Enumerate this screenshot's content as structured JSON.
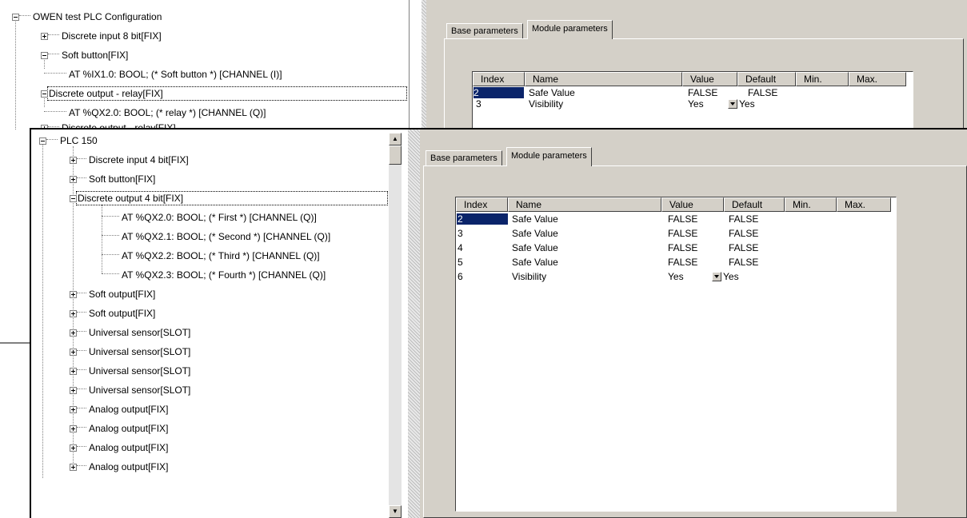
{
  "back_window": {
    "tree": {
      "root": "OWEN test PLC Configuration",
      "items": [
        {
          "label": "Discrete input 8 bit[FIX]"
        },
        {
          "label": "Soft button[FIX]"
        },
        {
          "label": "AT %IX1.0: BOOL; (* Soft button *) [CHANNEL (I)]"
        },
        {
          "label": "Discrete output - relay[FIX]"
        },
        {
          "label": "AT %QX2.0: BOOL; (* relay *) [CHANNEL (Q)]"
        },
        {
          "label": "Discrete output - relay[FIX]"
        }
      ]
    },
    "tabs": {
      "base": "Base parameters",
      "module": "Module parameters"
    },
    "grid": {
      "columns": [
        "Index",
        "Name",
        "Value",
        "Default",
        "Min.",
        "Max."
      ],
      "rows": [
        {
          "index": "2",
          "name": "Safe Value",
          "value": "FALSE",
          "default": "FALSE"
        },
        {
          "index": "3",
          "name": "Visibility",
          "value": "Yes",
          "default": "Yes"
        }
      ]
    }
  },
  "front_window": {
    "tree": {
      "root": "PLC 150",
      "items": [
        {
          "label": "Discrete input 4 bit[FIX]"
        },
        {
          "label": "Soft button[FIX]"
        },
        {
          "label": "Discrete output 4 bit[FIX]"
        },
        {
          "label": "AT %QX2.0: BOOL; (* First *) [CHANNEL (Q)]"
        },
        {
          "label": "AT %QX2.1: BOOL; (* Second *) [CHANNEL (Q)]"
        },
        {
          "label": "AT %QX2.2: BOOL; (* Third *) [CHANNEL (Q)]"
        },
        {
          "label": "AT %QX2.3: BOOL; (* Fourth *) [CHANNEL (Q)]"
        },
        {
          "label": "Soft output[FIX]"
        },
        {
          "label": "Soft output[FIX]"
        },
        {
          "label": "Universal sensor[SLOT]"
        },
        {
          "label": "Universal sensor[SLOT]"
        },
        {
          "label": "Universal sensor[SLOT]"
        },
        {
          "label": "Universal sensor[SLOT]"
        },
        {
          "label": "Analog output[FIX]"
        },
        {
          "label": "Analog output[FIX]"
        },
        {
          "label": "Analog output[FIX]"
        },
        {
          "label": "Analog output[FIX]"
        }
      ]
    },
    "tabs": {
      "base": "Base parameters",
      "module": "Module parameters"
    },
    "grid": {
      "columns": [
        "Index",
        "Name",
        "Value",
        "Default",
        "Min.",
        "Max."
      ],
      "rows": [
        {
          "index": "2",
          "name": "Safe Value",
          "value": "FALSE",
          "default": "FALSE"
        },
        {
          "index": "3",
          "name": "Safe Value",
          "value": "FALSE",
          "default": "FALSE"
        },
        {
          "index": "4",
          "name": "Safe Value",
          "value": "FALSE",
          "default": "FALSE"
        },
        {
          "index": "5",
          "name": "Safe Value",
          "value": "FALSE",
          "default": "FALSE"
        },
        {
          "index": "6",
          "name": "Visibility",
          "value": "Yes",
          "default": "Yes"
        }
      ]
    }
  },
  "icons": {
    "expand": "plus-box-icon",
    "collapse": "minus-box-icon",
    "scroll_up": "arrow-up-icon",
    "scroll_down": "arrow-down-icon",
    "dropdown": "chevron-down-icon"
  },
  "colors": {
    "selection": "#0a246a",
    "face": "#d4d0c8",
    "window": "#ffffff"
  }
}
